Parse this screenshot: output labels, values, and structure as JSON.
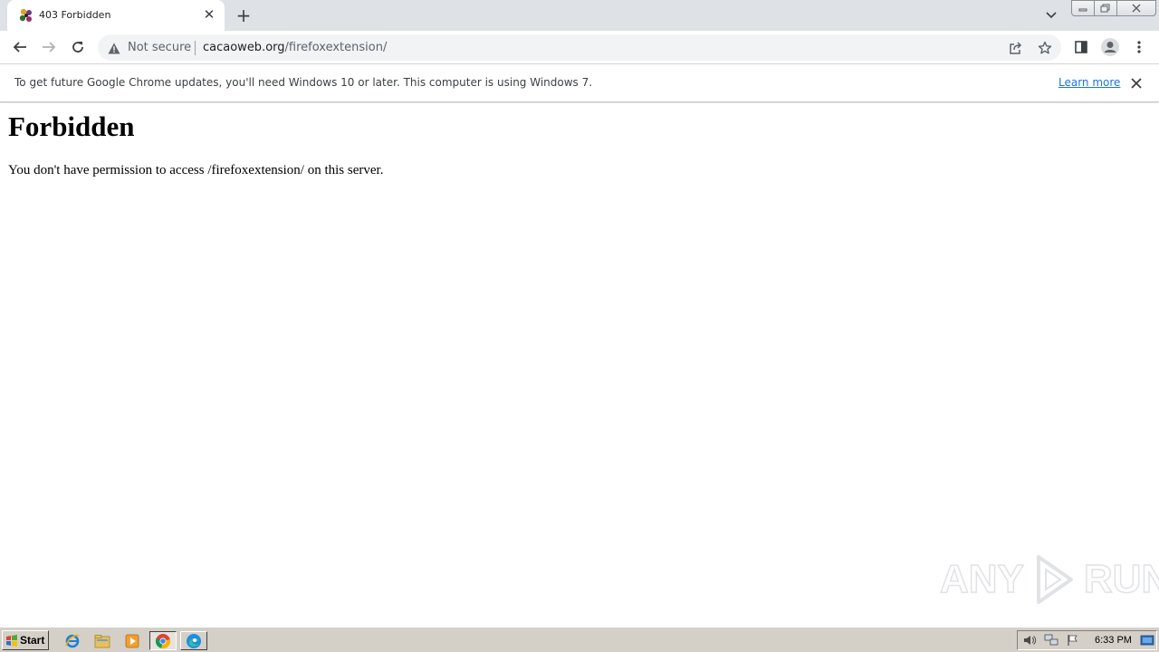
{
  "browser": {
    "tab": {
      "title": "403 Forbidden",
      "favicon": "cacaoweb-favicon"
    },
    "omnibox": {
      "security_label": "Not secure",
      "url_domain": "cacaoweb.org",
      "url_path": "/firefoxextension/"
    },
    "infobar": {
      "message": "To get future Google Chrome updates, you'll need Windows 10 or later. This computer is using Windows 7.",
      "link": "Learn more"
    }
  },
  "page": {
    "heading": "Forbidden",
    "message": "You don't have permission to access /firefoxextension/ on this server."
  },
  "watermark": {
    "text_left": "ANY",
    "text_right": "RUN"
  },
  "taskbar": {
    "start_label": "Start",
    "clock": "6:33 PM",
    "apps": [
      "internet-explorer-icon",
      "explorer-folder-icon",
      "media-player-icon",
      "chrome-icon",
      "edge-icon"
    ]
  },
  "colors": {
    "tabstrip": "#dee1e6",
    "link": "#1a73e8",
    "taskbar": "#d4d0c8"
  }
}
